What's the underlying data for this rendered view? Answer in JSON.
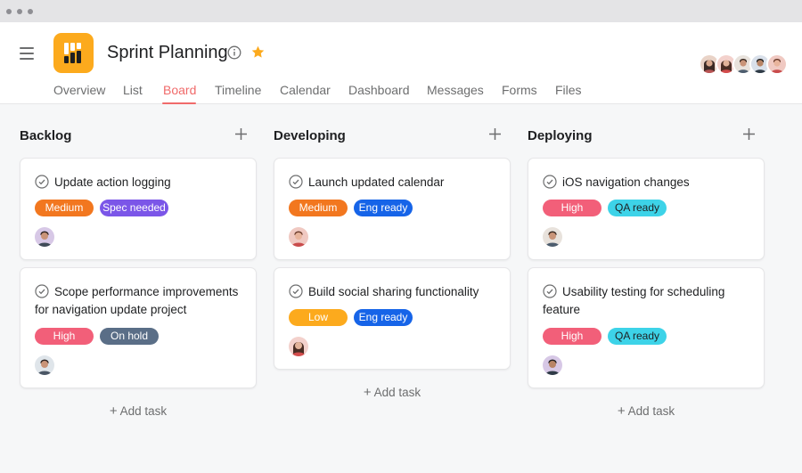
{
  "project": {
    "title": "Sprint Planning"
  },
  "tabs": [
    "Overview",
    "List",
    "Board",
    "Timeline",
    "Calendar",
    "Dashboard",
    "Messages",
    "Forms",
    "Files"
  ],
  "active_tab": "Board",
  "colors": {
    "accent": "#f06a6a",
    "logo": "#fcaa1d",
    "star": "#fcaa1d",
    "tag_medium": "#f2771f",
    "tag_high": "#f25f79",
    "tag_low": "#fcaa1d",
    "tag_spec_needed": "#7b56e8",
    "tag_eng_ready": "#1664e8",
    "tag_qa_ready": "#3dd3e8",
    "tag_on_hold": "#5a6e87"
  },
  "add_task_label": "Add task",
  "columns": [
    {
      "title": "Backlog",
      "cards": [
        {
          "title": "Update action logging",
          "tags": [
            "Medium",
            "Spec needed"
          ]
        },
        {
          "title": "Scope performance improvements for navigation update project",
          "tags": [
            "High",
            "On hold"
          ]
        }
      ]
    },
    {
      "title": "Developing",
      "cards": [
        {
          "title": "Launch updated calendar",
          "tags": [
            "Medium",
            "Eng ready"
          ]
        },
        {
          "title": "Build social sharing functionality",
          "tags": [
            "Low",
            "Eng ready"
          ]
        }
      ]
    },
    {
      "title": "Deploying",
      "cards": [
        {
          "title": "iOS navigation changes",
          "tags": [
            "High",
            "QA ready"
          ]
        },
        {
          "title": "Usability testing for scheduling feature",
          "tags": [
            "High",
            "QA ready"
          ]
        }
      ]
    }
  ]
}
